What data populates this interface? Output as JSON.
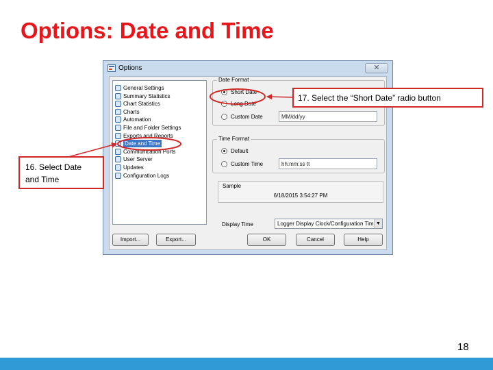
{
  "slide": {
    "title": "Options: Date and Time",
    "page_number": "18"
  },
  "colors": {
    "title": "#e8151b",
    "annotation": "#d22727",
    "footer_band": "#2e9bd6"
  },
  "dialog": {
    "title": "Options",
    "close_label": "✕",
    "nav_items": [
      {
        "label": "General Settings",
        "icon": "settings-icon"
      },
      {
        "label": "Summary Statistics",
        "icon": "statistics-icon"
      },
      {
        "label": "Chart Statistics",
        "icon": "chart-statistics-icon"
      },
      {
        "label": "Charts",
        "icon": "chart-icon"
      },
      {
        "label": "Automation",
        "icon": "automation-icon"
      },
      {
        "label": "File and Folder Settings",
        "icon": "folder-icon"
      },
      {
        "label": "Exports and Reports",
        "icon": "report-icon"
      },
      {
        "label": "Date and Time",
        "icon": "calendar-icon",
        "selected": true
      },
      {
        "label": "Communication Ports",
        "icon": "port-icon"
      },
      {
        "label": "User Server",
        "icon": "user-server-icon"
      },
      {
        "label": "Updates",
        "icon": "update-arrow-icon"
      },
      {
        "label": "Configuration Logs",
        "icon": "log-icon"
      }
    ],
    "date_format": {
      "legend": "Date Format",
      "short_date": "Short Date",
      "long_date": "Long Date",
      "custom_date": "Custom Date",
      "custom_value": "MM/dd/yy",
      "selected": "short_date"
    },
    "time_format": {
      "legend": "Time Format",
      "default": "Default",
      "custom_time": "Custom Time",
      "custom_value": "hh:mm:ss tt",
      "selected": "default"
    },
    "sample": {
      "label": "Sample",
      "value": "6/18/2015 3:54:27 PM"
    },
    "display_time": {
      "label": "Display Time",
      "selected": "Logger Display Clock/Configuration Time"
    },
    "buttons": {
      "import": "Import...",
      "export": "Export...",
      "ok": "OK",
      "cancel": "Cancel",
      "help": "Help"
    }
  },
  "callouts": {
    "step17": "17.  Select the “Short Date” radio button",
    "step16": "16. Select Date and Time"
  }
}
